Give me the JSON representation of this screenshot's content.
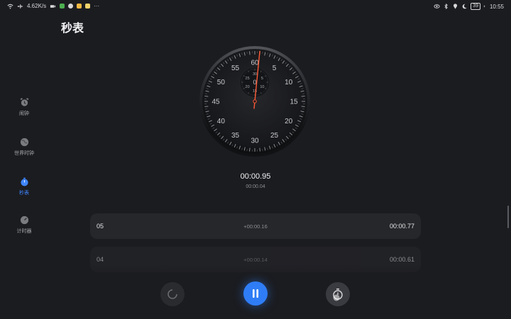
{
  "status_bar": {
    "net_speed": "4.62K/s",
    "more": "···",
    "battery": "39",
    "time": "10:55"
  },
  "page": {
    "title": "秒表"
  },
  "nav": [
    {
      "label": "闹钟",
      "icon": "alarm-clock-icon",
      "active": false
    },
    {
      "label": "世界时钟",
      "icon": "globe-icon",
      "active": false
    },
    {
      "label": "秒表",
      "icon": "stopwatch-icon",
      "active": true
    },
    {
      "label": "计时器",
      "icon": "timer-icon",
      "active": false
    }
  ],
  "dial": {
    "labels": [
      "60",
      "5",
      "10",
      "15",
      "20",
      "25",
      "30",
      "35",
      "40",
      "45",
      "50",
      "55"
    ],
    "sub_labels": [
      "30",
      "5",
      "10",
      "15",
      "20",
      "25"
    ],
    "sub_center": "0",
    "hand_seconds": 0.95,
    "accent": "#ff5a36"
  },
  "timer": {
    "main": "00:00.95",
    "sub": "00:00.04"
  },
  "laps": [
    {
      "num": "05",
      "diff": "+00:00.16",
      "total": "00:00.77"
    },
    {
      "num": "04",
      "diff": "+00:00.14",
      "total": "00:00.61"
    }
  ],
  "controls": {
    "reset": "reset-icon",
    "pause": "pause-icon",
    "lap": "lap-stopwatch-icon",
    "accent": "#2f7df6"
  }
}
